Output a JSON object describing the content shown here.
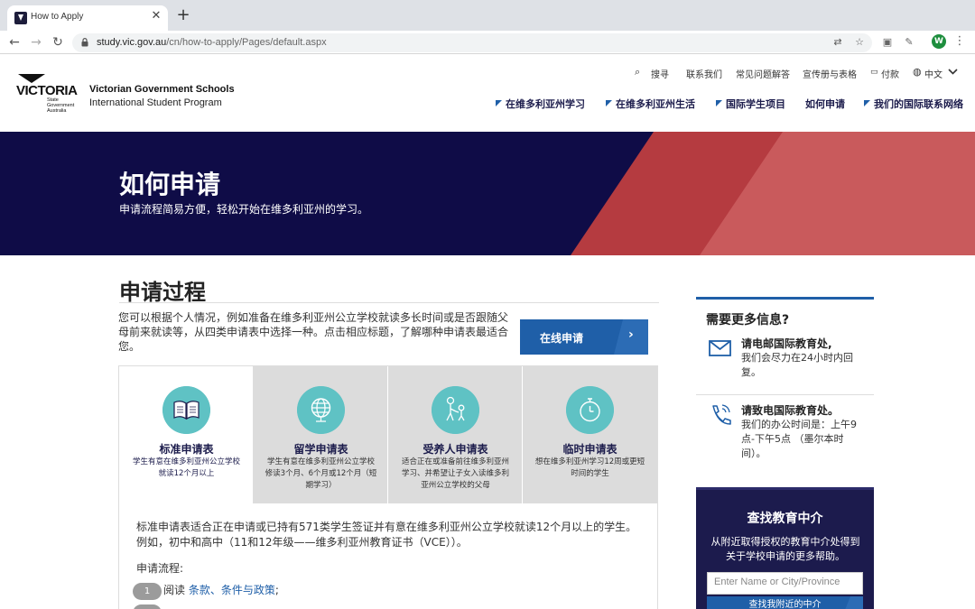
{
  "browser": {
    "tab_title": "How to Apply",
    "url_host": "study.vic.gov.au",
    "url_path": "/cn/how-to-apply/Pages/default.aspx",
    "profile_initial": "W"
  },
  "header": {
    "logo_word": "VICTORIA",
    "logo_sub_1": "State",
    "logo_sub_2": "Government",
    "logo_sub_3": "Australia",
    "brand_line1": "Victorian Government Schools",
    "brand_line2": "International Student Program",
    "utility": {
      "search": "搜寻",
      "contact": "联系我们",
      "faq": "常见问题解答",
      "brochures": "宣传册与表格",
      "payment": "付款",
      "language": "中文"
    },
    "nav": [
      "在维多利亚州学习",
      "在维多利亚州生活",
      "国际学生项目",
      "如何申请",
      "我们的国际联系网络"
    ]
  },
  "hero": {
    "title": "如何申请",
    "subtitle": "申请流程简易方便，轻松开始在维多利亚州的学习。"
  },
  "main": {
    "section_title": "申请过程",
    "intro": "您可以根据个人情况，例如准备在维多利亚州公立学校就读多长时间或是否跟随父母前来就读等，从四类申请表中选择一种。点击相应标题，了解哪种申请表最适合您。",
    "apply_button": "在线申请",
    "form_tabs": [
      {
        "title": "标准申请表",
        "desc": "学生有意在维多利亚州公立学校就读12个月以上",
        "icon": "book-icon"
      },
      {
        "title": "留学申请表",
        "desc": "学生有意在维多利亚州公立学校修读3个月、6个月或12个月（短期学习）",
        "icon": "globe-icon"
      },
      {
        "title": "受养人申请表",
        "desc": "适合正在或准备前往维多利亚州学习、并希望让子女入读维多利亚州公立学校的父母",
        "icon": "parent-child-icon"
      },
      {
        "title": "临时申请表",
        "desc": "想在维多利亚州学习12周或更短时间的学生",
        "icon": "stopwatch-icon"
      }
    ],
    "body_text": "标准申请表适合正在申请或已持有571类学生签证并有意在维多利亚州公立学校就读12个月以上的学生。例如，初中和高中（11和12年级——维多利亚州教育证书（VCE））。",
    "process_label": "申请流程:",
    "step1": {
      "number": "1",
      "prefix": "阅读 ",
      "link": "条款、条件与政策",
      "suffix": ";"
    }
  },
  "sidebar": {
    "info_title": "需要更多信息?",
    "email_title": "请电邮国际教育处,",
    "email_text": "我们会尽力在24小时内回复。",
    "phone_title": "请致电国际教育处。",
    "phone_text": "我们的办公时间是：上午9点-下午5点 （墨尔本时间）。",
    "agent_title": "查找教育中介",
    "agent_text": "从附近取得授权的教育中介处得到关于学校申请的更多帮助。",
    "agent_placeholder": "Enter Name or City/Province",
    "agent_button": "查找我附近的中介"
  },
  "colors": {
    "hero_bg": "#0f0c47",
    "accent_blue": "#1f5fa8",
    "stripe_red": "#b53b40",
    "icon_teal": "#5fc2c4"
  }
}
